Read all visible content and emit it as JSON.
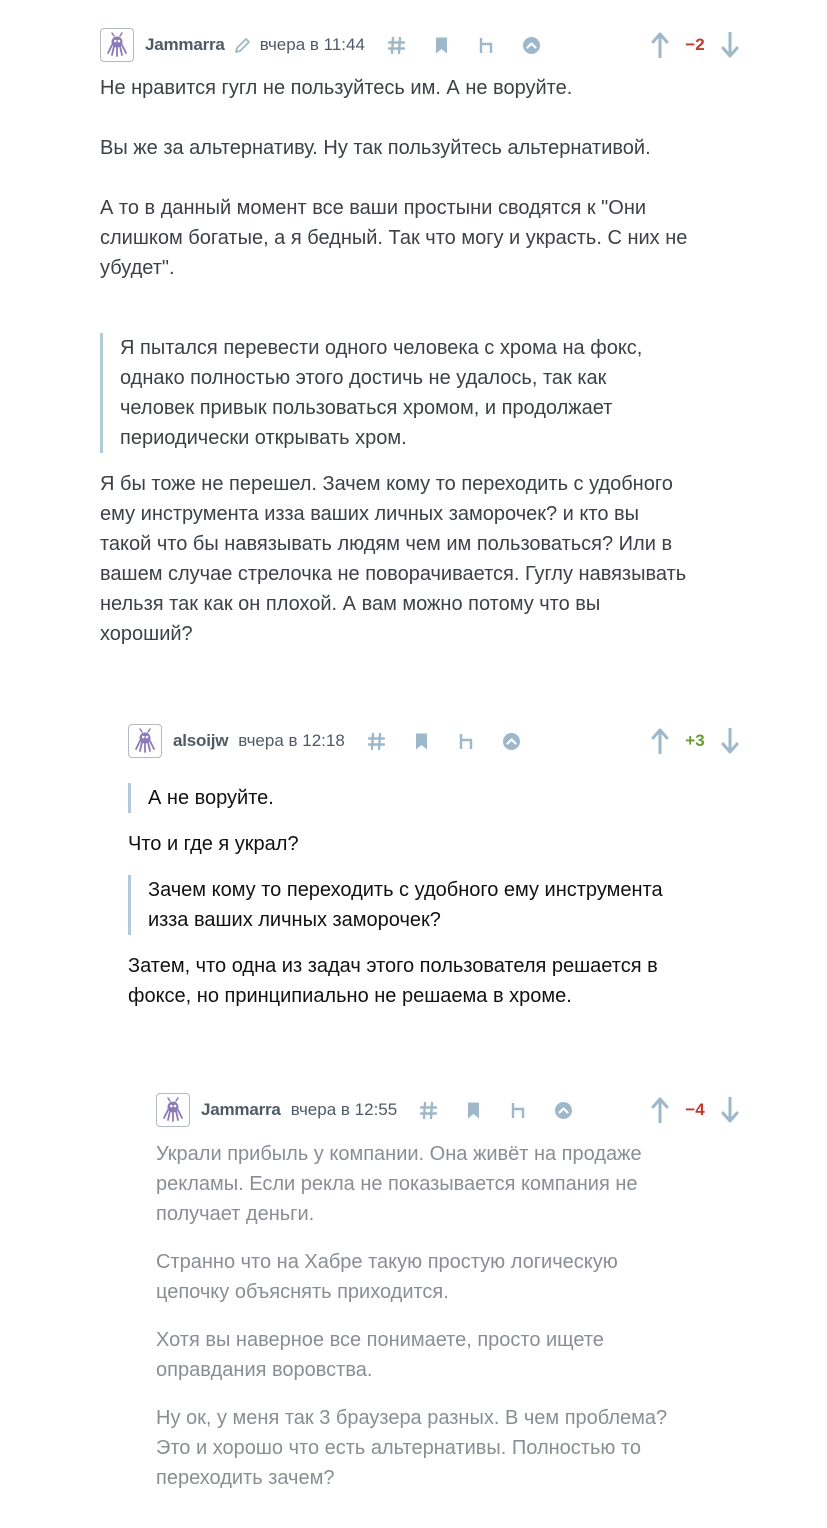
{
  "comments": [
    {
      "username": "Jammarra",
      "time": "вчера в 11:44",
      "score": "−2",
      "body": {
        "p1": "Не нравится гугл не пользуйтесь им. А не воруйте.",
        "p2": "Вы же за альтернативу. Ну так пользуйтесь альтернативой.",
        "p3_line1": "А то в данный момент все ваши простыни сводятся к \"Они",
        "p3_line2": "слишком богатые, а я бедный. Так что могу и украсть. С них не",
        "p3_line3": "убудет\".",
        "quote_line1": "Я пытался перевести одного человека с хрома на фокс,",
        "quote_line2": "однако полностью этого достичь не удалось, так как",
        "quote_line3": "человек привык пользоваться хромом, и продолжает",
        "quote_line4": "периодически открывать хром.",
        "p4_line1": "Я бы тоже не перешел. Зачем кому то переходить с удобного",
        "p4_line2": "ему инструмента изза ваших личных заморочек? и кто вы",
        "p4_line3": "такой что бы навязывать людям чем им пользоваться? Или в",
        "p4_line4": "вашем случае стрелочка не поворачивается. Гуглу навязывать",
        "p4_line5": "нельзя так как он плохой. А вам можно потому что вы",
        "p4_line6": "хороший?"
      }
    },
    {
      "username": "alsoijw",
      "time": "вчера в 12:18",
      "score": "+3",
      "body": {
        "quote1": "А не воруйте.",
        "p1": "Что и где я украл?",
        "quote2_line1": "Зачем кому то переходить с удобного ему инструмента",
        "quote2_line2": "изза ваших личных заморочек?",
        "p2_line1": "Затем, что одна из задач этого пользователя решается в",
        "p2_line2": "фоксе, но принципиально не решаема в хроме."
      }
    },
    {
      "username": "Jammarra",
      "time": "вчера в 12:55",
      "score": "−4",
      "body": {
        "p1_line1": "Украли прибыль у компании. Она живёт на продаже",
        "p1_line2": "рекламы. Если рекла не показывается компания не",
        "p1_line3": "получает деньги.",
        "p2_line1": "Странно что на Хабре такую простую логическую",
        "p2_line2": "цепочку объяснять приходится.",
        "p3_line1": "Хотя вы наверное все понимаете, просто ищете",
        "p3_line2": "оправдания воровства.",
        "p4_line1": "Ну ок, у меня так 3 браузера разных. В чем проблема?",
        "p4_line2": "Это и хорошо что есть альтернативы. Полностью то",
        "p4_line3": "переходить зачем?"
      }
    }
  ],
  "colors": {
    "icon": "#9fb8c9",
    "avatar_accent": "#8b7ab8",
    "score_negative": "#c0392b",
    "score_positive": "#6a9c36",
    "quote_border": "#b3cad8"
  },
  "icons": [
    "avatar",
    "edit-pencil-icon",
    "hash-icon",
    "bookmark-icon",
    "reply-parent-icon",
    "collapse-up-icon",
    "vote-up-icon",
    "vote-down-icon"
  ]
}
